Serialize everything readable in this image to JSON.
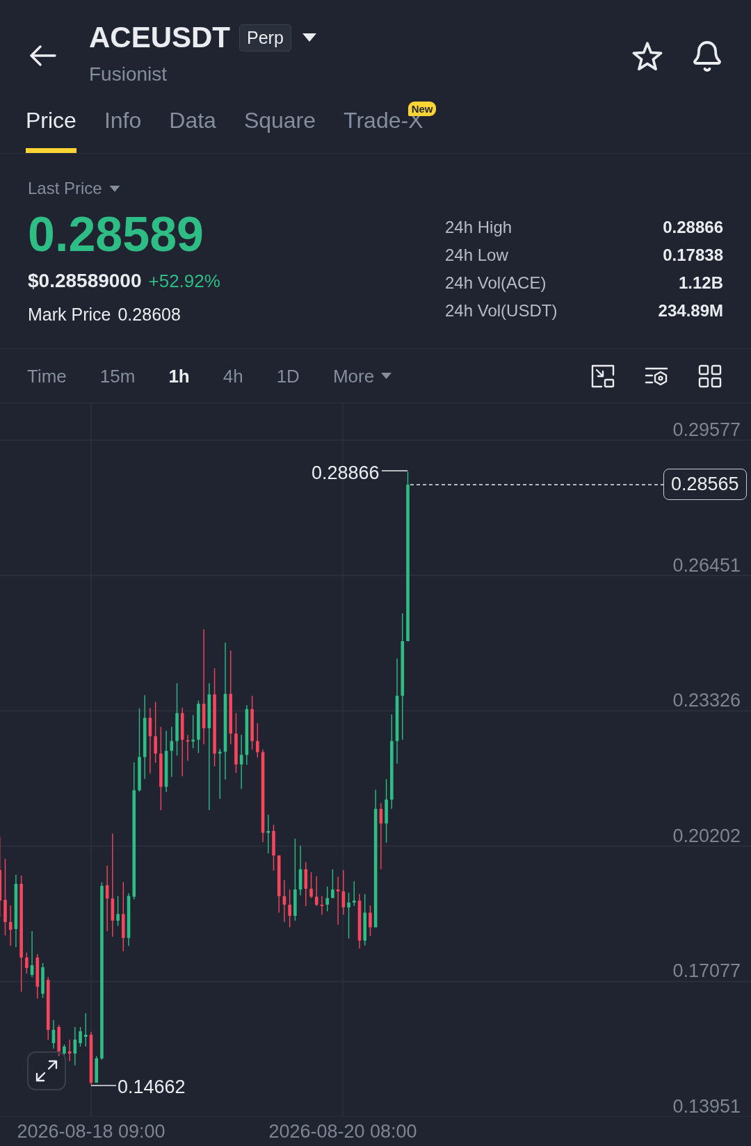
{
  "header": {
    "symbol": "ACEUSDT",
    "contract_type": "Perp",
    "name": "Fusionist"
  },
  "tabs": [
    {
      "label": "Price",
      "selected": true
    },
    {
      "label": "Info",
      "selected": false
    },
    {
      "label": "Data",
      "selected": false
    },
    {
      "label": "Square",
      "selected": false
    },
    {
      "label": "Trade-X",
      "selected": false,
      "badge": "New"
    }
  ],
  "price": {
    "selector": "Last Price",
    "last": "0.28589",
    "usd_value": "$0.28589000",
    "change": "+52.92%",
    "mark_label": "Mark Price",
    "mark_value": "0.28608"
  },
  "stats": [
    {
      "label": "24h High",
      "value": "0.28866"
    },
    {
      "label": "24h Low",
      "value": "0.17838"
    },
    {
      "label": "24h Vol(ACE)",
      "value": "1.12B"
    },
    {
      "label": "24h Vol(USDT)",
      "value": "234.89M"
    }
  ],
  "intervals": [
    {
      "kind": "option",
      "label": "Time",
      "selected": false
    },
    {
      "kind": "option",
      "label": "15m",
      "selected": false
    },
    {
      "kind": "option",
      "label": "1h",
      "selected": true
    },
    {
      "kind": "option",
      "label": "4h",
      "selected": false
    },
    {
      "kind": "option",
      "label": "1D",
      "selected": false
    },
    {
      "kind": "dropdown",
      "label": "More",
      "selected": false
    }
  ],
  "chart": {
    "price_ticks": [
      "0.29577",
      "0.26451",
      "0.23326",
      "0.20202",
      "0.17077",
      "0.13951"
    ],
    "time_labels": [
      "2026-08-18 09:00",
      "2026-08-20 08:00"
    ],
    "high_marker": "0.28866",
    "low_marker": "0.14662",
    "current_price": "0.28565"
  }
}
